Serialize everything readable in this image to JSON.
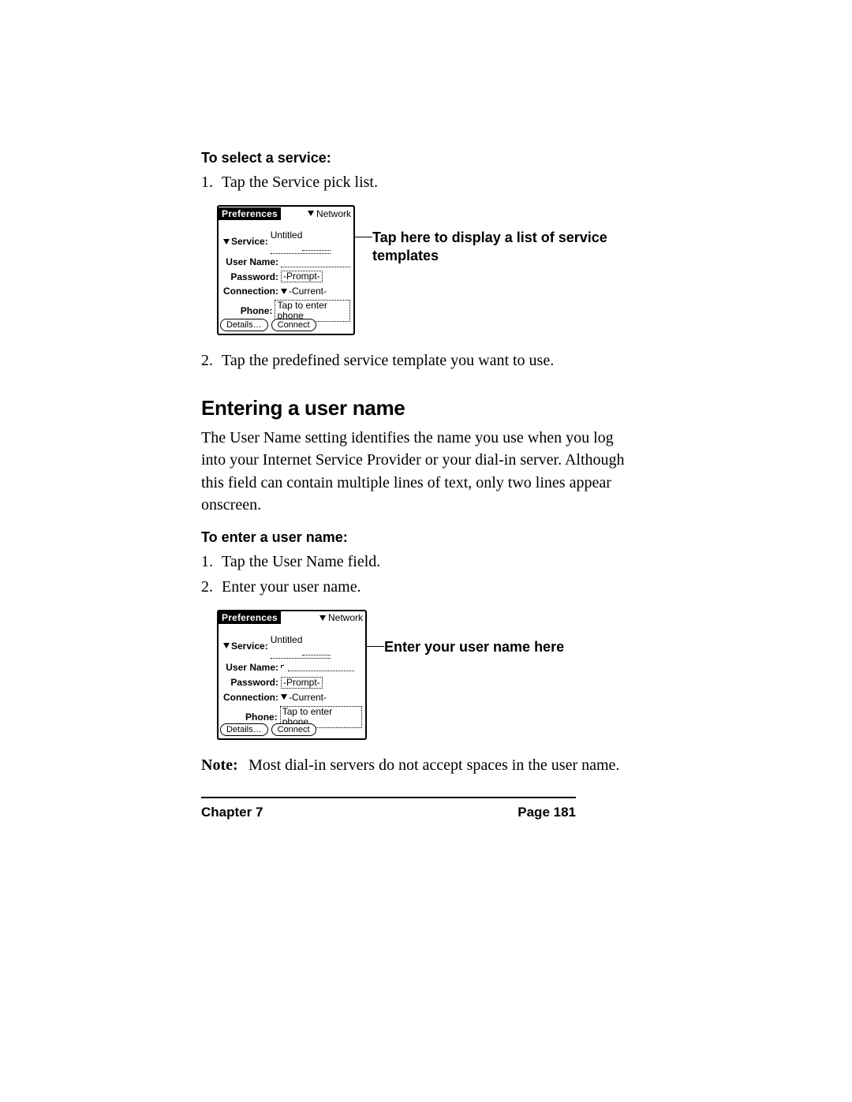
{
  "section1": {
    "heading": "To select a service:",
    "step1_num": "1.",
    "step1_text": "Tap the Service pick list.",
    "step2_num": "2.",
    "step2_text": "Tap the predefined service template you want to use."
  },
  "fig1": {
    "callout": "Tap here to display a list of service templates",
    "panel": {
      "title": "Preferences",
      "topPick": "Network",
      "rows": {
        "service_label": "Service:",
        "service_value": "Untitled",
        "username_label": "User Name:",
        "username_value": "",
        "password_label": "Password:",
        "password_value": "-Prompt-",
        "connection_label": "Connection:",
        "connection_value": "-Current-",
        "phone_label": "Phone:",
        "phone_value": "Tap to enter phone"
      },
      "buttons": {
        "details": "Details…",
        "connect": "Connect"
      }
    }
  },
  "section2": {
    "heading": "Entering a user name",
    "para": "The User Name setting identifies the name you use when you log into your Internet Service Provider or your dial-in server. Although this field can contain multiple lines of text, only two lines appear onscreen.",
    "subhead": "To enter a user name:",
    "step1_num": "1.",
    "step1_text": "Tap the User Name field.",
    "step2_num": "2.",
    "step2_text": "Enter your user name."
  },
  "fig2": {
    "callout": "Enter your user name here",
    "panel": {
      "title": "Preferences",
      "topPick": "Network",
      "rows": {
        "service_label": "Service:",
        "service_value": "Untitled",
        "username_label": "User Name:",
        "username_value": "",
        "password_label": "Password:",
        "password_value": "-Prompt-",
        "connection_label": "Connection:",
        "connection_value": "-Current-",
        "phone_label": "Phone:",
        "phone_value": "Tap to enter phone"
      },
      "buttons": {
        "details": "Details…",
        "connect": "Connect"
      }
    }
  },
  "note": {
    "label": "Note:",
    "text": "Most dial-in servers do not accept spaces in the user name."
  },
  "footer": {
    "left": "Chapter 7",
    "right": "Page 181"
  }
}
